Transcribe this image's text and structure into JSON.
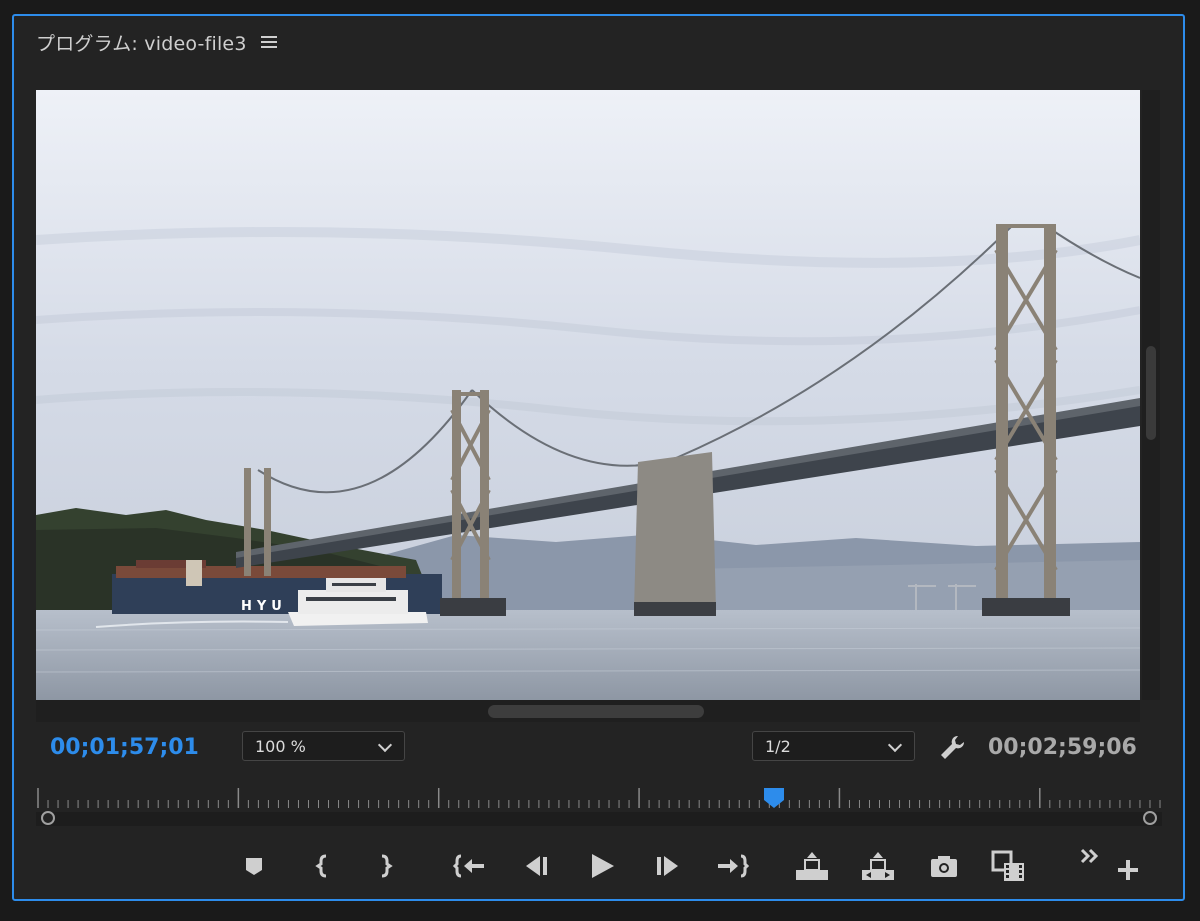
{
  "panel": {
    "title": "プログラム: video-file3",
    "menu_icon": "hamburger-menu-icon"
  },
  "viewer": {
    "content": "video-frame-bay-bridge"
  },
  "playback": {
    "current_timecode": "00;01;57;01",
    "zoom_level": "100 %",
    "resolution": "1/2",
    "duration_timecode": "00;02;59;06",
    "playhead_fraction": 0.655
  },
  "colors": {
    "accent": "#2d8ceb",
    "panel_bg": "#232323",
    "icon": "#cfcfcf"
  },
  "controls": {
    "icons": [
      "add-marker-icon",
      "mark-in-icon",
      "mark-out-icon",
      "go-to-in-icon",
      "step-back-icon",
      "play-icon",
      "step-forward-icon",
      "go-to-out-icon",
      "lift-icon",
      "extract-icon",
      "export-frame-icon",
      "comparison-view-icon",
      "more-icon",
      "button-editor-icon"
    ]
  }
}
